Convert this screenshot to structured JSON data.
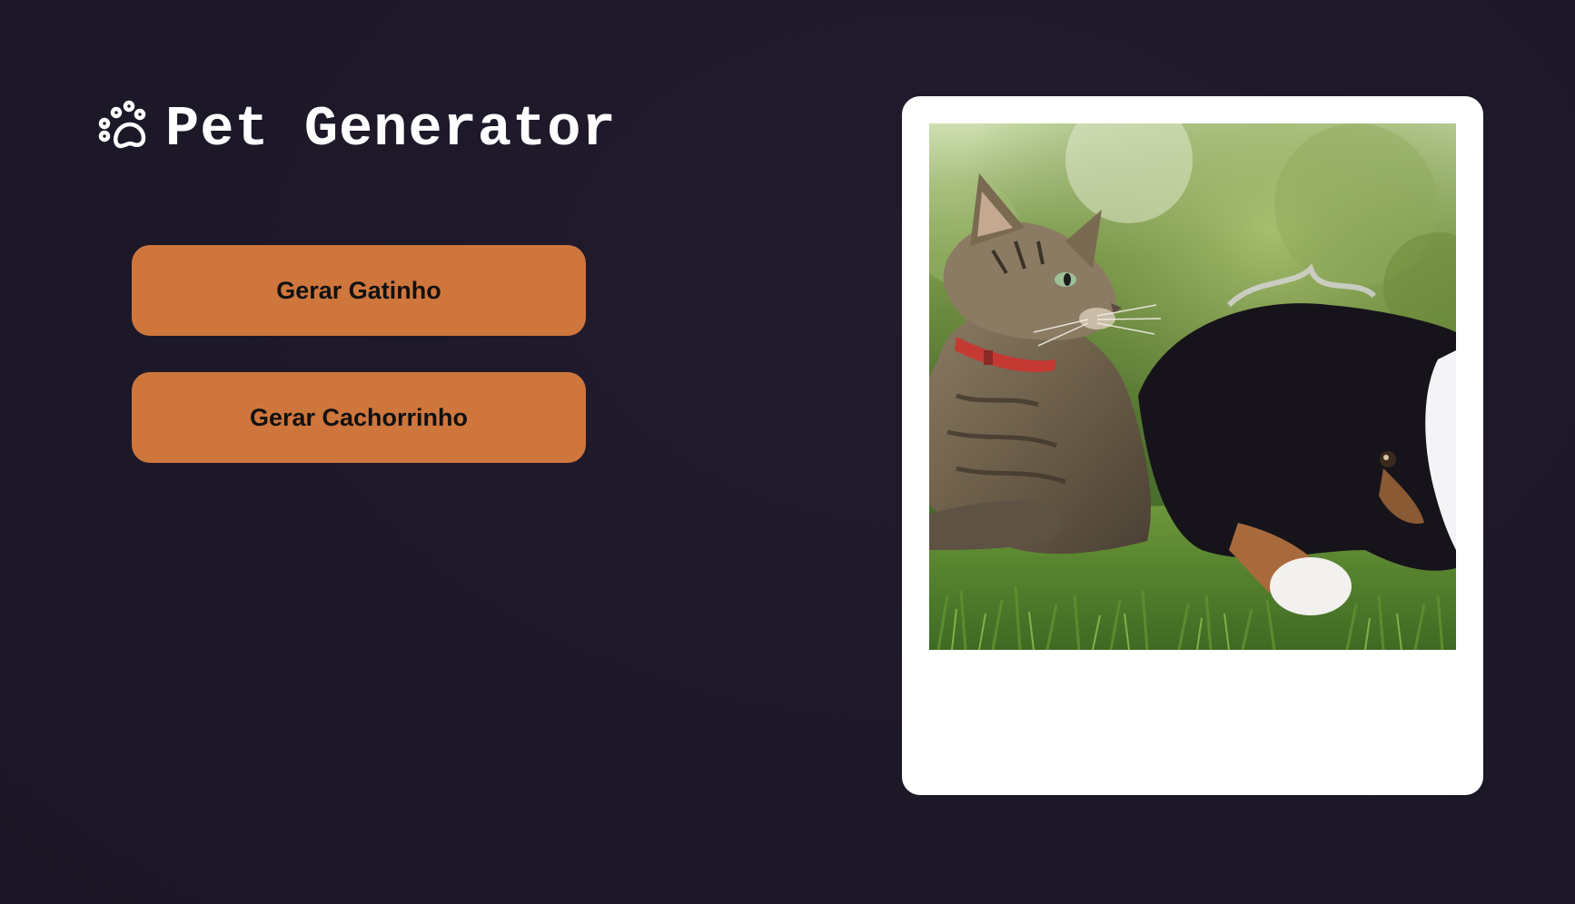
{
  "header": {
    "icon": "paw-icon",
    "title": "Pet Generator"
  },
  "buttons": {
    "cat_label": "Gerar Gatinho",
    "dog_label": "Gerar Cachorrinho"
  },
  "image_card": {
    "image": "photo of a tabby cat and a black-and-white puppy lying on grass"
  },
  "colors": {
    "background": "#1d1828",
    "button": "#cf763d",
    "button_text": "#111111",
    "title_text": "#ffffff",
    "card": "#ffffff"
  }
}
